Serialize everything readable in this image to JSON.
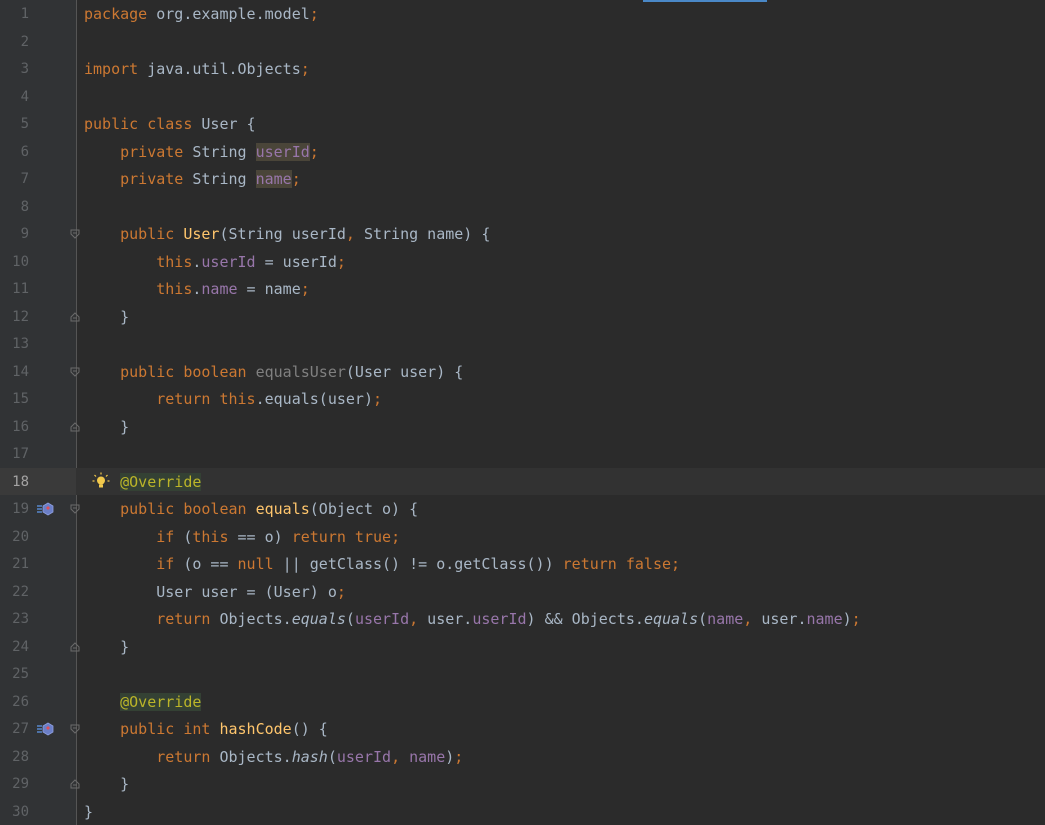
{
  "editor": {
    "current_line": 18
  },
  "lines": [
    {
      "n": "1",
      "tokens": [
        [
          "kw",
          "package"
        ],
        [
          "p",
          " org.example.model"
        ],
        [
          "pun",
          ";"
        ]
      ]
    },
    {
      "n": "2",
      "tokens": []
    },
    {
      "n": "3",
      "tokens": [
        [
          "kw",
          "import"
        ],
        [
          "p",
          " java.util.Objects"
        ],
        [
          "pun",
          ";"
        ]
      ]
    },
    {
      "n": "4",
      "tokens": []
    },
    {
      "n": "5",
      "tokens": [
        [
          "kw",
          "public class"
        ],
        [
          "p",
          " User {"
        ]
      ]
    },
    {
      "n": "6",
      "tokens": [
        [
          "p",
          "    "
        ],
        [
          "kw",
          "private"
        ],
        [
          "p",
          " String "
        ],
        [
          "fldhl",
          "userId"
        ],
        [
          "pun",
          ";"
        ]
      ]
    },
    {
      "n": "7",
      "tokens": [
        [
          "p",
          "    "
        ],
        [
          "kw",
          "private"
        ],
        [
          "p",
          " String "
        ],
        [
          "fldhl",
          "name"
        ],
        [
          "pun",
          ";"
        ]
      ]
    },
    {
      "n": "8",
      "tokens": []
    },
    {
      "n": "9",
      "fold": "open",
      "tokens": [
        [
          "p",
          "    "
        ],
        [
          "kw",
          "public"
        ],
        [
          "p",
          " "
        ],
        [
          "mth",
          "User"
        ],
        [
          "p",
          "(String userId"
        ],
        [
          "pun",
          ","
        ],
        [
          "p",
          " String name) {"
        ]
      ]
    },
    {
      "n": "10",
      "tokens": [
        [
          "p",
          "        "
        ],
        [
          "kw",
          "this"
        ],
        [
          "p",
          "."
        ],
        [
          "fld",
          "userId"
        ],
        [
          "p",
          " = userId"
        ],
        [
          "pun",
          ";"
        ]
      ]
    },
    {
      "n": "11",
      "tokens": [
        [
          "p",
          "        "
        ],
        [
          "kw",
          "this"
        ],
        [
          "p",
          "."
        ],
        [
          "fld",
          "name"
        ],
        [
          "p",
          " = name"
        ],
        [
          "pun",
          ";"
        ]
      ]
    },
    {
      "n": "12",
      "fold": "close",
      "tokens": [
        [
          "p",
          "    }"
        ]
      ]
    },
    {
      "n": "13",
      "tokens": []
    },
    {
      "n": "14",
      "fold": "open",
      "tokens": [
        [
          "p",
          "    "
        ],
        [
          "kw",
          "public boolean"
        ],
        [
          "p",
          " "
        ],
        [
          "unu",
          "equalsUser"
        ],
        [
          "p",
          "(User user) {"
        ]
      ]
    },
    {
      "n": "15",
      "tokens": [
        [
          "p",
          "        "
        ],
        [
          "kw",
          "return this"
        ],
        [
          "p",
          ".equals(user)"
        ],
        [
          "pun",
          ";"
        ]
      ]
    },
    {
      "n": "16",
      "fold": "close",
      "tokens": [
        [
          "p",
          "    }"
        ]
      ]
    },
    {
      "n": "17",
      "tokens": []
    },
    {
      "n": "18",
      "bulb": true,
      "tokens": [
        [
          "p",
          "    "
        ],
        [
          "ann",
          "@Override"
        ]
      ]
    },
    {
      "n": "19",
      "fold": "open",
      "override": true,
      "tokens": [
        [
          "p",
          "    "
        ],
        [
          "kw",
          "public boolean"
        ],
        [
          "p",
          " "
        ],
        [
          "mth",
          "equals"
        ],
        [
          "p",
          "(Object o) {"
        ]
      ]
    },
    {
      "n": "20",
      "tokens": [
        [
          "p",
          "        "
        ],
        [
          "kw",
          "if"
        ],
        [
          "p",
          " ("
        ],
        [
          "kw",
          "this"
        ],
        [
          "p",
          " == o) "
        ],
        [
          "kw",
          "return true"
        ],
        [
          "pun",
          ";"
        ]
      ]
    },
    {
      "n": "21",
      "tokens": [
        [
          "p",
          "        "
        ],
        [
          "kw",
          "if"
        ],
        [
          "p",
          " (o == "
        ],
        [
          "kw",
          "null"
        ],
        [
          "p",
          " || getClass() != o.getClass()) "
        ],
        [
          "kw",
          "return false"
        ],
        [
          "pun",
          ";"
        ]
      ]
    },
    {
      "n": "22",
      "tokens": [
        [
          "p",
          "        User user = (User) o"
        ],
        [
          "pun",
          ";"
        ]
      ]
    },
    {
      "n": "23",
      "tokens": [
        [
          "p",
          "        "
        ],
        [
          "kw",
          "return"
        ],
        [
          "p",
          " Objects."
        ],
        [
          "ital",
          "equals"
        ],
        [
          "p",
          "("
        ],
        [
          "fld",
          "userId"
        ],
        [
          "pun",
          ","
        ],
        [
          "p",
          " user."
        ],
        [
          "fld",
          "userId"
        ],
        [
          "p",
          ") && Objects."
        ],
        [
          "ital",
          "equals"
        ],
        [
          "p",
          "("
        ],
        [
          "fld",
          "name"
        ],
        [
          "pun",
          ","
        ],
        [
          "p",
          " user."
        ],
        [
          "fld",
          "name"
        ],
        [
          "p",
          ")"
        ],
        [
          "pun",
          ";"
        ]
      ]
    },
    {
      "n": "24",
      "fold": "close",
      "tokens": [
        [
          "p",
          "    }"
        ]
      ]
    },
    {
      "n": "25",
      "tokens": []
    },
    {
      "n": "26",
      "tokens": [
        [
          "p",
          "    "
        ],
        [
          "ann",
          "@Override"
        ]
      ]
    },
    {
      "n": "27",
      "fold": "open",
      "override": true,
      "tokens": [
        [
          "p",
          "    "
        ],
        [
          "kw",
          "public int"
        ],
        [
          "p",
          " "
        ],
        [
          "mth",
          "hashCode"
        ],
        [
          "p",
          "() {"
        ]
      ]
    },
    {
      "n": "28",
      "tokens": [
        [
          "p",
          "        "
        ],
        [
          "kw",
          "return"
        ],
        [
          "p",
          " Objects."
        ],
        [
          "ital",
          "hash"
        ],
        [
          "p",
          "("
        ],
        [
          "fld",
          "userId"
        ],
        [
          "pun",
          ","
        ],
        [
          "p",
          " "
        ],
        [
          "fld",
          "name"
        ],
        [
          "p",
          ")"
        ],
        [
          "pun",
          ";"
        ]
      ]
    },
    {
      "n": "29",
      "fold": "close",
      "tokens": [
        [
          "p",
          "    }"
        ]
      ]
    },
    {
      "n": "30",
      "tokens": [
        [
          "p",
          "}"
        ]
      ]
    }
  ]
}
